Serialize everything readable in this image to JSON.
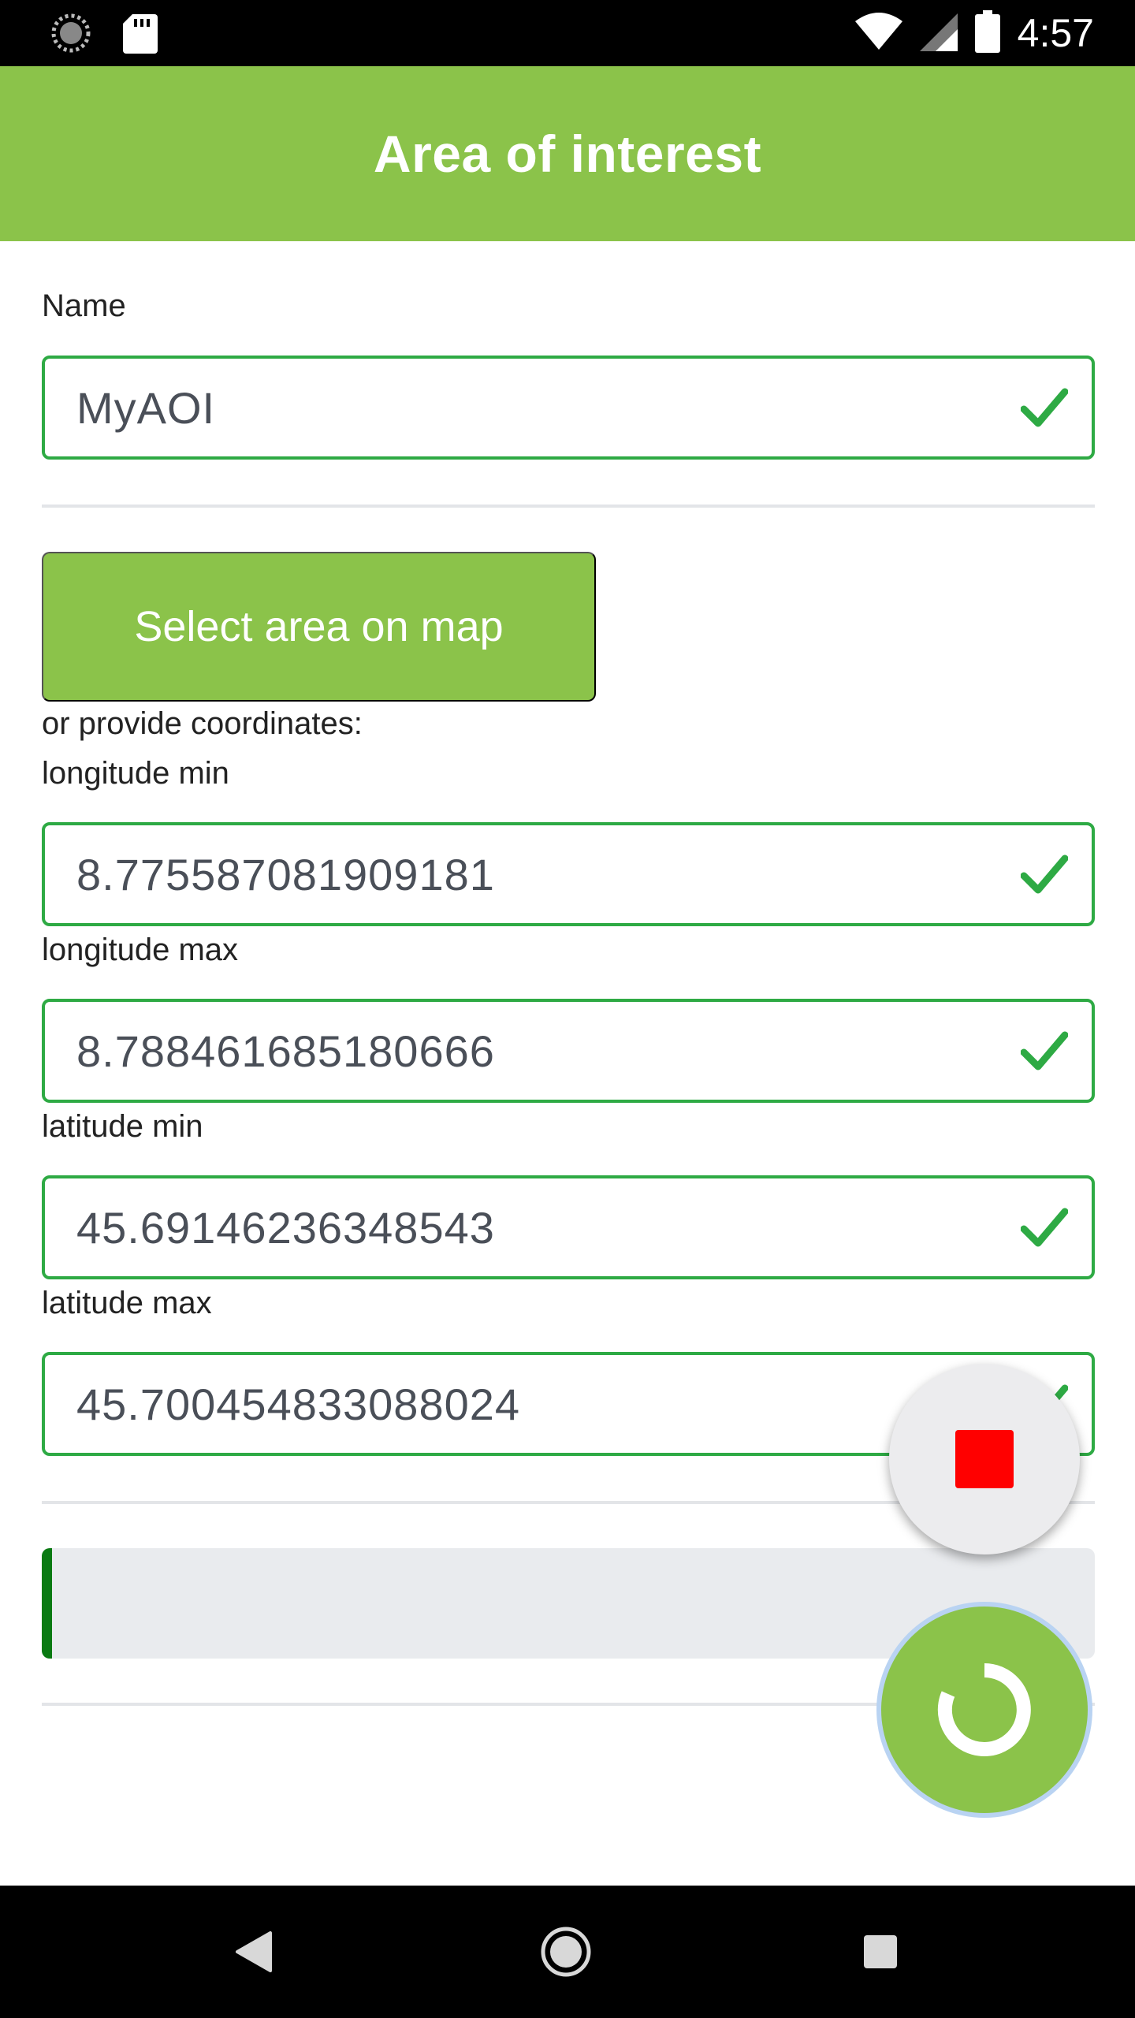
{
  "status_bar": {
    "time": "4:57",
    "icons": [
      "sync-icon",
      "sd-card-icon",
      "wifi-icon",
      "cell-signal-icon",
      "battery-icon"
    ]
  },
  "app_bar": {
    "title": "Area of interest"
  },
  "form": {
    "name_label": "Name",
    "name_value": "MyAOI",
    "select_map_label": "Select area on map",
    "coordinates_hint": "or provide coordinates:",
    "lon_min_label": "longitude min",
    "lon_min_value": "8.775587081909181",
    "lon_max_label": "longitude max",
    "lon_max_value": "8.788461685180666",
    "lat_min_label": "latitude min",
    "lat_min_value": "45.69146236348543",
    "lat_max_label": "latitude max",
    "lat_max_value": "45.700454833088024"
  },
  "progress": {
    "fraction": 0.01
  },
  "colors": {
    "accent": "#8bc34a",
    "valid_border": "#2eaa44",
    "progress_fill": "#0a7a12",
    "stop_red": "#ff0000"
  },
  "fabs": {
    "stop_icon": "stop-icon",
    "run_icon": "loading-spinner-icon"
  },
  "nav_bar": {
    "icons": [
      "back-icon",
      "home-icon",
      "recents-icon"
    ]
  }
}
